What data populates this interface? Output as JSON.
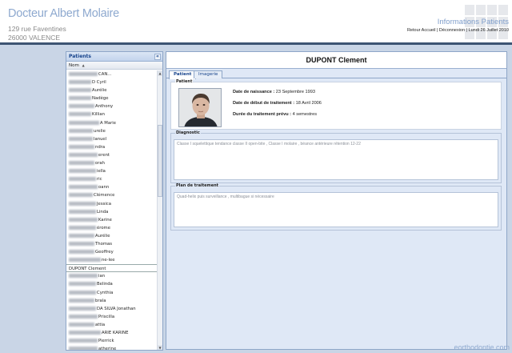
{
  "header": {
    "doctor_name": "Docteur Albert Molaire",
    "address_line1": "129 rue Faventines",
    "address_line2": "26000 VALENCE",
    "section_title": "Informations Patients",
    "nav_home": "Retour Accueil",
    "nav_sep1": " | ",
    "nav_logout": "Déconnexion",
    "nav_sep2": " | ",
    "date": "Lundi 26 Juillet 2010"
  },
  "sidebar": {
    "title": "Patients",
    "collapse_icon": "«",
    "column_header": "Nom",
    "sort_icon": "▲",
    "patients": [
      {
        "blur": 36,
        "name": "CAN..."
      },
      {
        "blur": 28,
        "name": "D Cyril"
      },
      {
        "blur": 28,
        "name": "Aurélie"
      },
      {
        "blur": 28,
        "name": "Nadège"
      },
      {
        "blur": 32,
        "name": "Anthony"
      },
      {
        "blur": 28,
        "name": "Killian"
      },
      {
        "blur": 38,
        "name": "A Marie"
      },
      {
        "blur": 30,
        "name": "urelie"
      },
      {
        "blur": 30,
        "name": "lanuel"
      },
      {
        "blur": 32,
        "name": "ndra"
      },
      {
        "blur": 36,
        "name": "erent"
      },
      {
        "blur": 32,
        "name": "orah"
      },
      {
        "blur": 34,
        "name": "iella"
      },
      {
        "blur": 34,
        "name": "ric"
      },
      {
        "blur": 36,
        "name": "oann"
      },
      {
        "blur": 30,
        "name": "Clémence"
      },
      {
        "blur": 34,
        "name": "Jessica"
      },
      {
        "blur": 34,
        "name": "Linda"
      },
      {
        "blur": 36,
        "name": "Karine"
      },
      {
        "blur": 34,
        "name": "érome"
      },
      {
        "blur": 32,
        "name": "Aurélie"
      },
      {
        "blur": 32,
        "name": "Thomas"
      },
      {
        "blur": 32,
        "name": "Geoffrey"
      },
      {
        "blur": 40,
        "name": "ne-lee"
      },
      {
        "blur": 0,
        "name": "DUPONT Clement"
      },
      {
        "blur": 36,
        "name": "ian"
      },
      {
        "blur": 34,
        "name": "Belinda"
      },
      {
        "blur": 34,
        "name": "Cynthia"
      },
      {
        "blur": 32,
        "name": "brala"
      },
      {
        "blur": 34,
        "name": "DA SILVA Jonathan"
      },
      {
        "blur": 36,
        "name": "Priscilla"
      },
      {
        "blur": 32,
        "name": "attia"
      },
      {
        "blur": 40,
        "name": "ARIE KARINE"
      },
      {
        "blur": 36,
        "name": "Pierrick"
      },
      {
        "blur": 36,
        "name": "atherine"
      }
    ],
    "selected_index": 24
  },
  "main": {
    "patient_name": "DUPONT Clement",
    "tabs": [
      {
        "label": "Patient",
        "active": true
      },
      {
        "label": "Imagerie",
        "active": false
      }
    ],
    "patient_section": {
      "legend": "Patient",
      "birth_label": "Date de naissance :",
      "birth_value": "23 Septembre 1993",
      "start_label": "Date de début de traitement :",
      "start_value": "18 Avril 2006",
      "duration_label": "Durée du traitement prévu :",
      "duration_value": "4 semestres"
    },
    "diagnostic": {
      "legend": "Diagnostic",
      "text": "Classe I squelettique tendance classe II open-bite , Classe I molaire , béance antérieure rétention 12-22"
    },
    "plan": {
      "legend": "Plan de traitement",
      "text": "Quad-helix puis surveillance , multibague si nécessaire"
    }
  },
  "watermark": "eorthodontie.com",
  "colors": {
    "accent": "#8ea9cf",
    "header_bar": "#3d5473",
    "panel_bg": "#dfe8f6"
  }
}
